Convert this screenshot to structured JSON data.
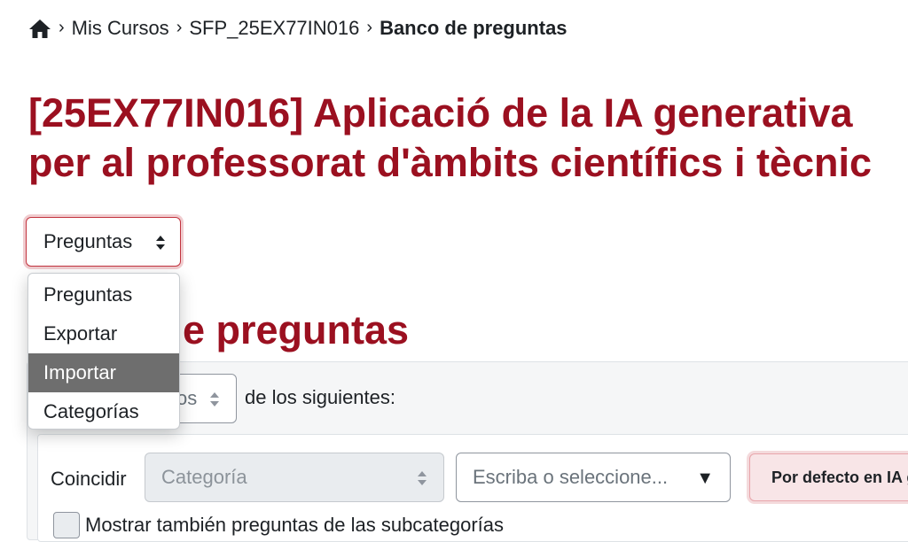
{
  "breadcrumb": {
    "items": [
      "Mis Cursos",
      "SFP_25EX77IN016"
    ],
    "current": "Banco de preguntas"
  },
  "course": {
    "title_line1": "[25EX77IN016] Aplicació de la IA generativa",
    "title_line2": "per al professorat d'àmbits científics i tècnic"
  },
  "nav_select": {
    "value": "Preguntas",
    "options": [
      "Preguntas",
      "Exportar",
      "Importar",
      "Categorías"
    ],
    "highlighted": "Importar"
  },
  "section": {
    "heading_visible": "e preguntas"
  },
  "filters": {
    "match_mode_visible": "os",
    "match_suffix": "de los siguientes:",
    "coincidir_label": "Coincidir",
    "category_placeholder": "Categoría",
    "search_placeholder": "Escriba o seleccione...",
    "default_badge": "Por defecto en IA g",
    "subcategories_label": "Mostrar también preguntas de las subcategorías"
  },
  "colors": {
    "brand": "#9b1020",
    "highlight": "#6e6e6e"
  }
}
